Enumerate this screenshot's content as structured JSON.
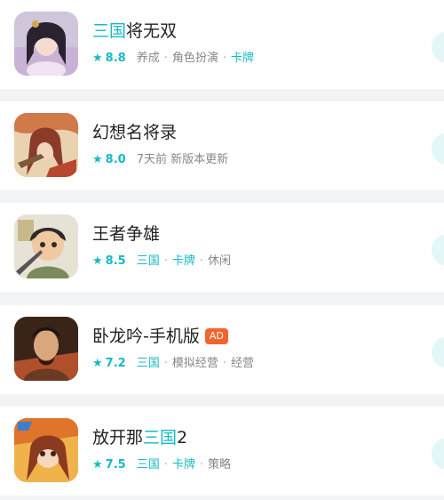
{
  "games": [
    {
      "title_parts": [
        {
          "text": "三国",
          "highlight": true
        },
        {
          "text": "将无双",
          "highlight": false
        }
      ],
      "ad": null,
      "score": "8.8",
      "tags": [
        {
          "text": "养成",
          "highlight": false
        },
        {
          "text": "角色扮演",
          "highlight": false
        },
        {
          "text": "卡牌",
          "highlight": true
        }
      ],
      "icon": "game-icon-sanguo-jiangwushuang"
    },
    {
      "title_parts": [
        {
          "text": "幻想名将录",
          "highlight": false
        }
      ],
      "ad": null,
      "score": "8.0",
      "tags": [
        {
          "text": "7天前 新版本更新",
          "highlight": false
        }
      ],
      "icon": "game-icon-huanxiang-mingjianglu"
    },
    {
      "title_parts": [
        {
          "text": "王者争雄",
          "highlight": false
        }
      ],
      "ad": null,
      "score": "8.5",
      "tags": [
        {
          "text": "三国",
          "highlight": true
        },
        {
          "text": "卡牌",
          "highlight": true
        },
        {
          "text": "休闲",
          "highlight": false
        }
      ],
      "icon": "game-icon-wangzhe-zhengxiong"
    },
    {
      "title_parts": [
        {
          "text": "卧龙吟-手机版",
          "highlight": false
        }
      ],
      "ad": "AD",
      "score": "7.2",
      "tags": [
        {
          "text": "三国",
          "highlight": true
        },
        {
          "text": "模拟经营",
          "highlight": false
        },
        {
          "text": "经营",
          "highlight": false
        }
      ],
      "icon": "game-icon-wolongyin"
    },
    {
      "title_parts": [
        {
          "text": "放开那",
          "highlight": false
        },
        {
          "text": "三国",
          "highlight": true
        },
        {
          "text": "2",
          "highlight": false
        }
      ],
      "ad": null,
      "score": "7.5",
      "tags": [
        {
          "text": "三国",
          "highlight": true
        },
        {
          "text": "卡牌",
          "highlight": true
        },
        {
          "text": "策略",
          "highlight": false
        }
      ],
      "icon": "game-icon-fangkainasanguo2"
    }
  ],
  "colors": {
    "accent": "#17b9c4",
    "ad_badge": "#f2652c",
    "title": "#222222",
    "meta": "#888888",
    "background": "#f2f3f5"
  }
}
